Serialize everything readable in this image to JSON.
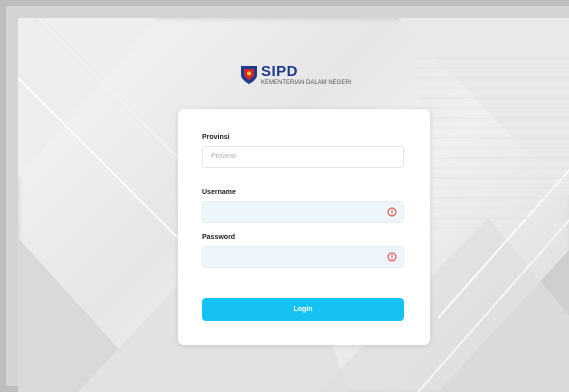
{
  "logo": {
    "title": "SIPD",
    "subtitle": "KEMENTERIAN DALAM NEGERI"
  },
  "form": {
    "provinsi_label": "Provinsi",
    "provinsi_placeholder": "Provinsi",
    "username_label": "Username",
    "username_value": "",
    "password_label": "Password",
    "password_value": "",
    "login_label": "Login"
  },
  "colors": {
    "accent": "#16c1f3",
    "brand": "#1f3a8f",
    "error": "#e53935"
  },
  "icons": {
    "logo": "sipd-shield-icon",
    "field_error": "error-circle-icon"
  }
}
